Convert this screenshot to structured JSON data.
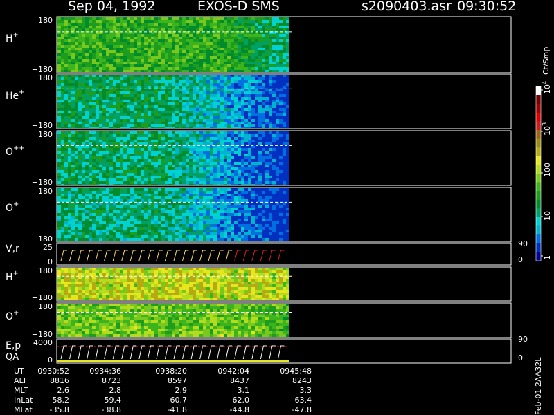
{
  "header": {
    "date": "Sep 04, 1992",
    "mission": "EXOS-D SMS",
    "file": "s2090403.asr",
    "time": "09:30:52"
  },
  "colorbar": {
    "label": "Ct/Smp",
    "ticks": [
      {
        "text": "1",
        "exp": ""
      },
      {
        "text": "10",
        "exp": ""
      },
      {
        "text": "100",
        "exp": ""
      },
      {
        "text": "10",
        "exp": "3"
      },
      {
        "text": "10",
        "exp": "4"
      }
    ],
    "colors": [
      "#000090",
      "#0030c0",
      "#0070e0",
      "#00b4d0",
      "#00d2d2",
      "#00a064",
      "#008c2c",
      "#1e9c1e",
      "#3cb41e",
      "#78c81e",
      "#b4dc1e",
      "#e6e61e",
      "#b4aa14",
      "#9a8c14",
      "#a06414",
      "#c81e1e",
      "#dc0000",
      "#a00000",
      "#780000",
      "#ffffff"
    ]
  },
  "footer": {
    "rows": [
      {
        "label": "UT",
        "values": [
          "0930:52",
          "0934:36",
          "0938:20",
          "0942:04",
          "0945:48"
        ]
      },
      {
        "label": "ALT",
        "values": [
          "8816",
          "8723",
          "8597",
          "8437",
          "8243"
        ]
      },
      {
        "label": "MLT",
        "values": [
          "2.6",
          "2.8",
          "2.9",
          "3.1",
          "3.3"
        ]
      },
      {
        "label": "InLat",
        "values": [
          "58.2",
          "59.4",
          "60.7",
          "62.0",
          "63.4"
        ]
      },
      {
        "label": "MLat",
        "values": [
          "-35.8",
          "-38.8",
          "-41.8",
          "-44.8",
          "-47.8"
        ]
      }
    ],
    "timestamp": "Feb-01 2AA32L"
  },
  "chart_data": {
    "type": "heatmap",
    "panels": [
      {
        "label": "H",
        "sup": "+",
        "ymax": "180",
        "ymin": "−180",
        "mean_level": 7.5,
        "dense_fraction": 0.7
      },
      {
        "label": "He",
        "sup": "+",
        "ymax": "180",
        "ymin": "−180",
        "mean_level": 5.5,
        "dense_fraction": 0.45
      },
      {
        "label": "O",
        "sup": "++",
        "ymax": "180",
        "ymin": "−180",
        "mean_level": 5.3,
        "dense_fraction": 0.45
      },
      {
        "label": "O",
        "sup": "+",
        "ymax": "180",
        "ymin": "−180",
        "mean_level": 5.0,
        "dense_fraction": 0.45
      },
      {
        "label": "V,r",
        "sup": "",
        "ymax": "25",
        "ymin": "0",
        "right_top": "90",
        "right_bot": "0",
        "line_panel": true
      },
      {
        "label": "H",
        "sup": "+",
        "ymax": "180",
        "ymin": "−180",
        "mean_level": 10.0,
        "dense_fraction": 0.9
      },
      {
        "label": "O",
        "sup": "+",
        "ymax": "180",
        "ymin": "−180",
        "mean_level": 8.8,
        "dense_fraction": 0.85
      },
      {
        "label": "E,p",
        "sub": "QA",
        "sup": "",
        "ymax": "4000",
        "ymin": "0",
        "right_top": "90",
        "right_bot": "0",
        "line_panel": true
      }
    ]
  }
}
